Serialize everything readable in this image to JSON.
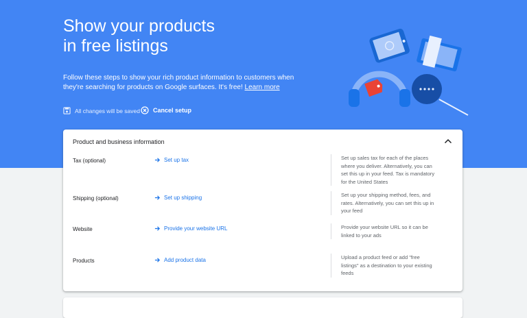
{
  "hero": {
    "title_line1": "Show your products",
    "title_line2": "in free listings",
    "description": "Follow these steps to show your rich product information to customers when they're searching for products on Google surfaces. It's free!",
    "learn_more": "Learn more",
    "save_status": "All changes will be saved",
    "cancel_label": "Cancel setup"
  },
  "card": {
    "header": "Product and business information",
    "rows": [
      {
        "label": "Tax (optional)",
        "link": "Set up tax",
        "desc": "Set up sales tax for each of the places where you deliver. Alternatively, you can set this up in your feed. Tax is mandatory for the United States"
      },
      {
        "label": "Shipping (optional)",
        "link": "Set up shipping",
        "desc": "Set up your shipping method, fees, and rates. Alternatively, you can set this up in your feed"
      },
      {
        "label": "Website",
        "link": "Provide your website URL",
        "desc": "Provide your website URL so it can be linked to your ads"
      },
      {
        "label": "Products",
        "link": "Add product data",
        "desc": "Upload a product feed or add \"free listings\" as a destination to your existing feeds"
      }
    ]
  },
  "colors": {
    "hero_bg": "#4285f4",
    "link": "#1a73e8",
    "page_bg": "#f1f3f4"
  }
}
